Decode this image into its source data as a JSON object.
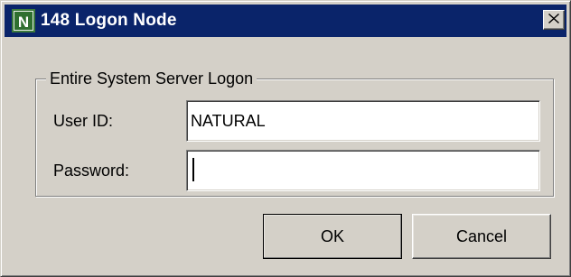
{
  "window": {
    "title": "148 Logon Node",
    "app_icon": "natural-n-icon",
    "close_icon": "close-x-icon",
    "titlebar_color": "#0a246a",
    "background_color": "#d4d0c8"
  },
  "group": {
    "label": "Entire System Server Logon"
  },
  "fields": {
    "user_id": {
      "label": "User ID:",
      "value": "NATURAL"
    },
    "password": {
      "label": "Password:",
      "value": ""
    }
  },
  "buttons": {
    "ok_label": "OK",
    "cancel_label": "Cancel"
  }
}
